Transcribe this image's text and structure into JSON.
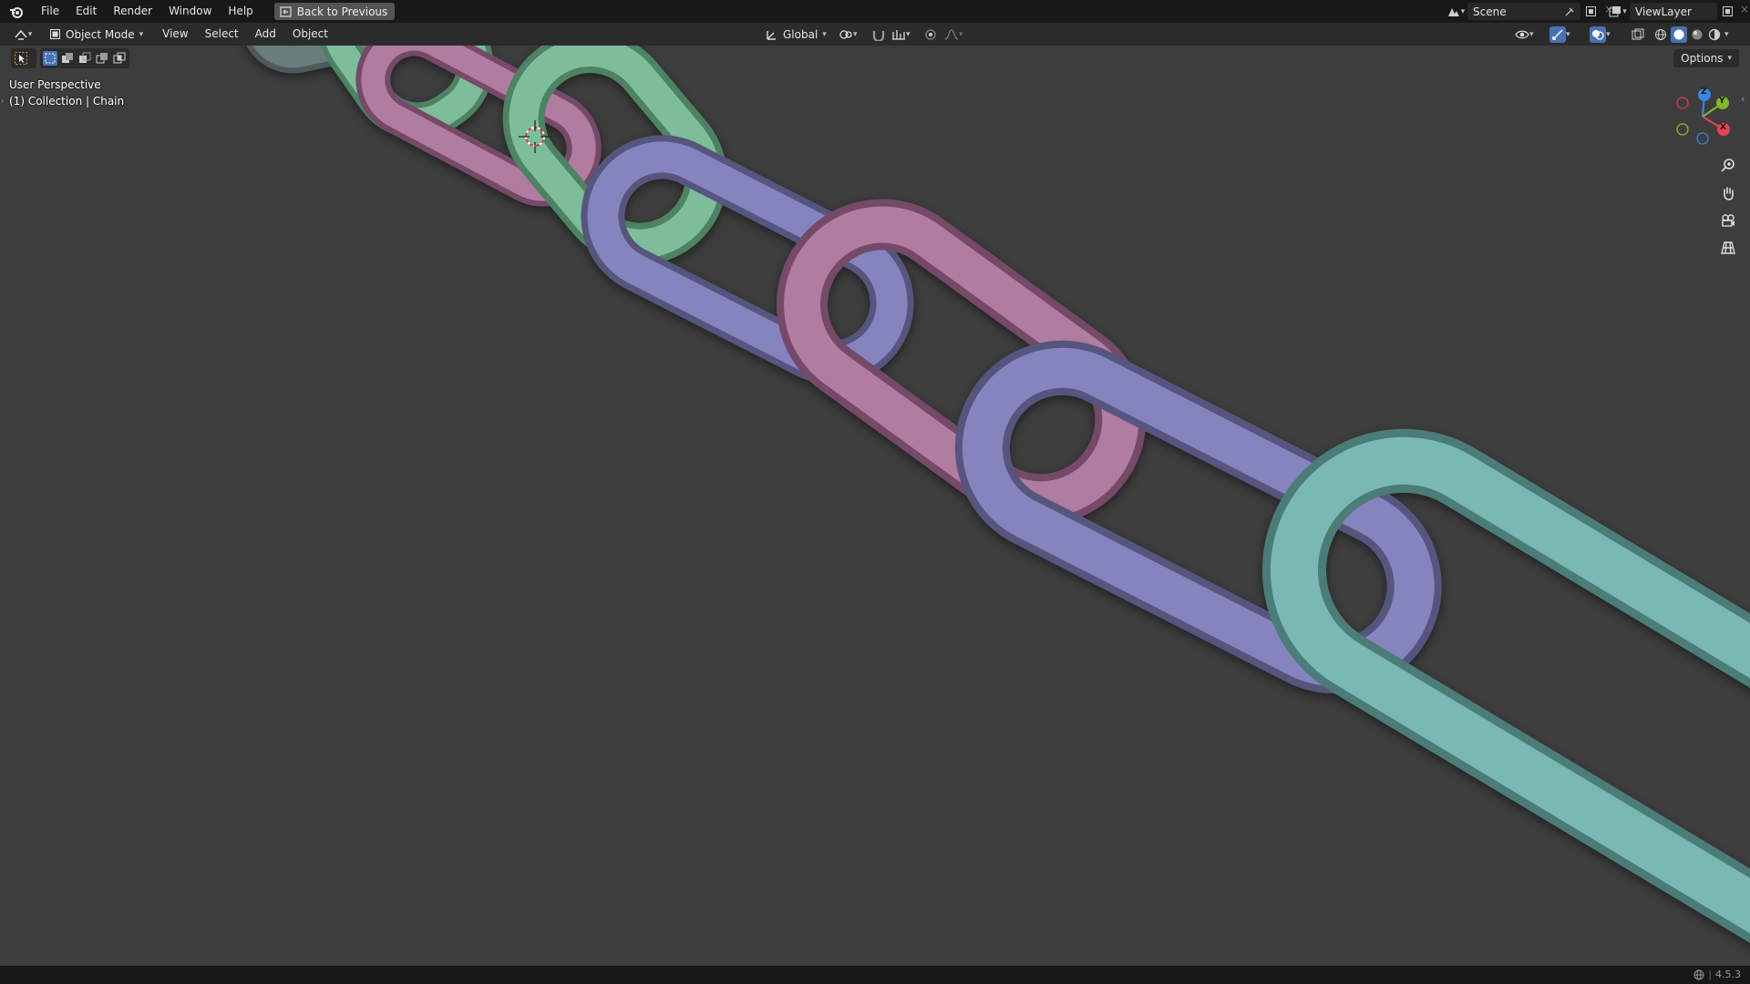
{
  "app": {
    "name": "Blender",
    "version": "4.5.3"
  },
  "topbar": {
    "menus": [
      "File",
      "Edit",
      "Render",
      "Window",
      "Help"
    ],
    "back_button": "Back to Previous",
    "scene": "Scene",
    "view_layer": "ViewLayer"
  },
  "header": {
    "mode": "Object Mode",
    "menus": [
      "View",
      "Select",
      "Add",
      "Object"
    ],
    "orientation": "Global"
  },
  "viewport": {
    "perspective": "User Perspective",
    "collection": "(1) Collection | Chain",
    "options": "Options",
    "gizmo_axes": [
      "X",
      "Y",
      "Z"
    ],
    "background": "#3d3d3d"
  },
  "colors": {
    "link_green": "#7dbd9a",
    "link_pink": "#b07ca0",
    "link_purple": "#8584bf",
    "link_teal": "#7ab8b4",
    "axis_x": "#e8434f",
    "axis_y": "#7fb729",
    "axis_z": "#3c86e6"
  },
  "icons": [
    "blender-logo-icon",
    "editor-type-icon",
    "select-box-icon",
    "transform-pivot-icon",
    "snap-icon",
    "proportional-edit-icon",
    "zoom-icon",
    "hand-pan-icon",
    "camera-view-icon",
    "grid-view-icon",
    "globe-icon"
  ]
}
